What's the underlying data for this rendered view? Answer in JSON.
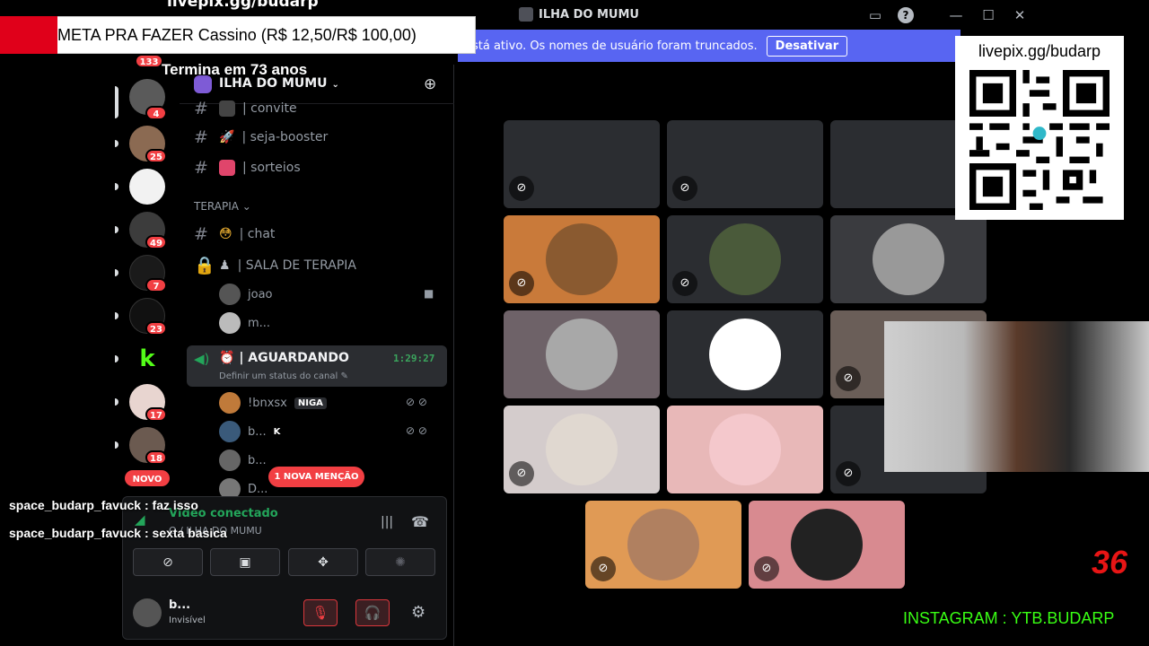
{
  "window": {
    "title": "ILHA DO MUMU"
  },
  "notice": {
    "text": "stá ativo. Os nomes de usuário foram truncados.",
    "button": "Desativar"
  },
  "servers": [
    {
      "badge": "133"
    },
    {
      "badge": "4"
    },
    {
      "badge": "25"
    },
    {
      "badge": ""
    },
    {
      "badge": "49"
    },
    {
      "badge": "7"
    },
    {
      "badge": "23"
    },
    {
      "badge": ""
    },
    {
      "badge": "17"
    },
    {
      "badge": "18"
    }
  ],
  "novo_label": "NOVO",
  "server_header": {
    "name": "ILHA DO MUMU"
  },
  "channels": [
    {
      "name": "| convite"
    },
    {
      "name": "| seja-booster"
    },
    {
      "name": "| sorteios"
    }
  ],
  "category": "TERAPIA",
  "channels2": [
    {
      "name": "| chat"
    },
    {
      "name": "| SALA DE TERAPIA"
    }
  ],
  "members_sala": [
    "joao",
    "m..."
  ],
  "voice": {
    "name": "| AGUARDANDO",
    "time": "1:29:27",
    "status": "Definir um status do canal"
  },
  "voice_members": [
    {
      "name": "!bnxsx",
      "tag": "NIGA"
    },
    {
      "name": "b...",
      "tag": "K"
    },
    {
      "name": "b...",
      "tag": ""
    },
    {
      "name": "D...",
      "tag": ""
    }
  ],
  "mention": "1 NOVA MENÇÃO",
  "voice_panel": {
    "connected": "Vídeo conectado",
    "channel": "O / ILHA DO MUMU"
  },
  "user": {
    "name": "b...",
    "status": "Invisível"
  },
  "tiles_colors": [
    "#2b2d31",
    "#2b2d31",
    "#2b2d31",
    "#c97a3a",
    "#2b2d31",
    "#3a3b3f",
    "#6e6268",
    "#2b2d31",
    "#6a5e58",
    "#d4cccc",
    "#e8b8b8",
    "#2b2d31",
    "#e09a55",
    "#d88a90"
  ],
  "overlay": {
    "url_top": "livepix.gg/budarp",
    "goal": "META PRA FAZER Cassino (R$ 12,50/R$ 100,00)",
    "ends": "Termina em 73 anos",
    "qr_url": "livepix.gg/budarp",
    "chat": [
      {
        "user": "space_budarp_favuck",
        "msg": "faz isso"
      },
      {
        "user": "space_budarp_favuck",
        "msg": "sexta basica"
      }
    ],
    "counter": "36",
    "instagram": "INSTAGRAM : YTB.BUDARP"
  }
}
